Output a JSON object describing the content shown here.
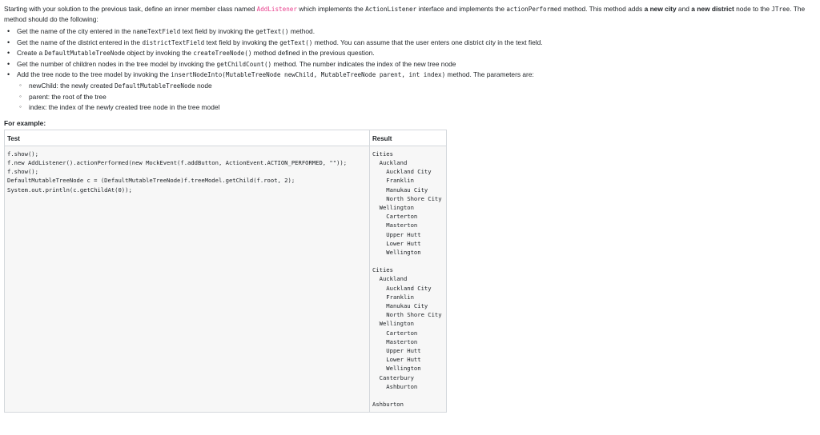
{
  "intro": {
    "t1": "Starting with your solution to the previous task, define an inner member class named ",
    "class_name": "AddListener",
    "t2": " which implements the ",
    "iface": "ActionListener",
    "t3": " interface and implements the ",
    "method": "actionPerformed",
    "t4": " method. This method adds ",
    "b1": "a new city",
    "t5": " and ",
    "b2": "a new district",
    "t6": " node to the ",
    "jtree": "JTree",
    "t7": ". The method should do the following:"
  },
  "bullets": [
    {
      "a": "Get the name of the city entered in the ",
      "c1": "nameTextField",
      "b": " text field by invoking the ",
      "c2": "getText()",
      "c": " method."
    },
    {
      "a": "Get the name of the district entered in the ",
      "c1": "districtTextField",
      "b": " text field by invoking the ",
      "c2": "getText()",
      "c": " method. You can assume that the user enters one district city in the text field."
    },
    {
      "a": "Create a ",
      "c1": "DefaultMutableTreeNode",
      "b": " object by invoking the ",
      "c2": "createTreeNode()",
      "c": " method defined in the previous question."
    },
    {
      "a": "Get the number of children nodes in the tree model by invoking the ",
      "c1": "getChildCount()",
      "b": " method. The number indicates the index of the new tree node",
      "c2": "",
      "c": ""
    },
    {
      "a": "Add the tree node to the tree model by invoking the ",
      "c1": "insertNodeInto(MutableTreeNode newChild, MutableTreeNode parent, int index)",
      "b": " method. The parameters are:",
      "c2": "",
      "c": ""
    }
  ],
  "params": [
    {
      "a": "newChild: the newly created ",
      "c1": "DefaultMutableTreeNode",
      "b": " node"
    },
    {
      "a": "parent: the root of the tree",
      "c1": "",
      "b": ""
    },
    {
      "a": "index: the index of the newly created tree node in the tree model",
      "c1": "",
      "b": ""
    }
  ],
  "example_label": "For example:",
  "table": {
    "header_test": "Test",
    "header_result": "Result",
    "test_lines": [
      "f.show();",
      "f.new AddListener().actionPerformed(new MockEvent(f.addButton, ActionEvent.ACTION_PERFORMED, \"\"));",
      "f.show();",
      "DefaultMutableTreeNode c = (DefaultMutableTreeNode)f.treeModel.getChild(f.root, 2);",
      "System.out.println(c.getChildAt(0));"
    ],
    "result_block1": [
      "Cities",
      "  Auckland",
      "    Auckland City",
      "    Franklin",
      "    Manukau City",
      "    North Shore City",
      "  Wellington",
      "    Carterton",
      "    Masterton",
      "    Upper Hutt",
      "    Lower Hutt",
      "    Wellington"
    ],
    "result_block2": [
      "Cities",
      "  Auckland",
      "    Auckland City",
      "    Franklin",
      "    Manukau City",
      "    North Shore City",
      "  Wellington",
      "    Carterton",
      "    Masterton",
      "    Upper Hutt",
      "    Lower Hutt",
      "    Wellington",
      "  Canterbury",
      "    Ashburton"
    ],
    "result_last": "Ashburton"
  }
}
